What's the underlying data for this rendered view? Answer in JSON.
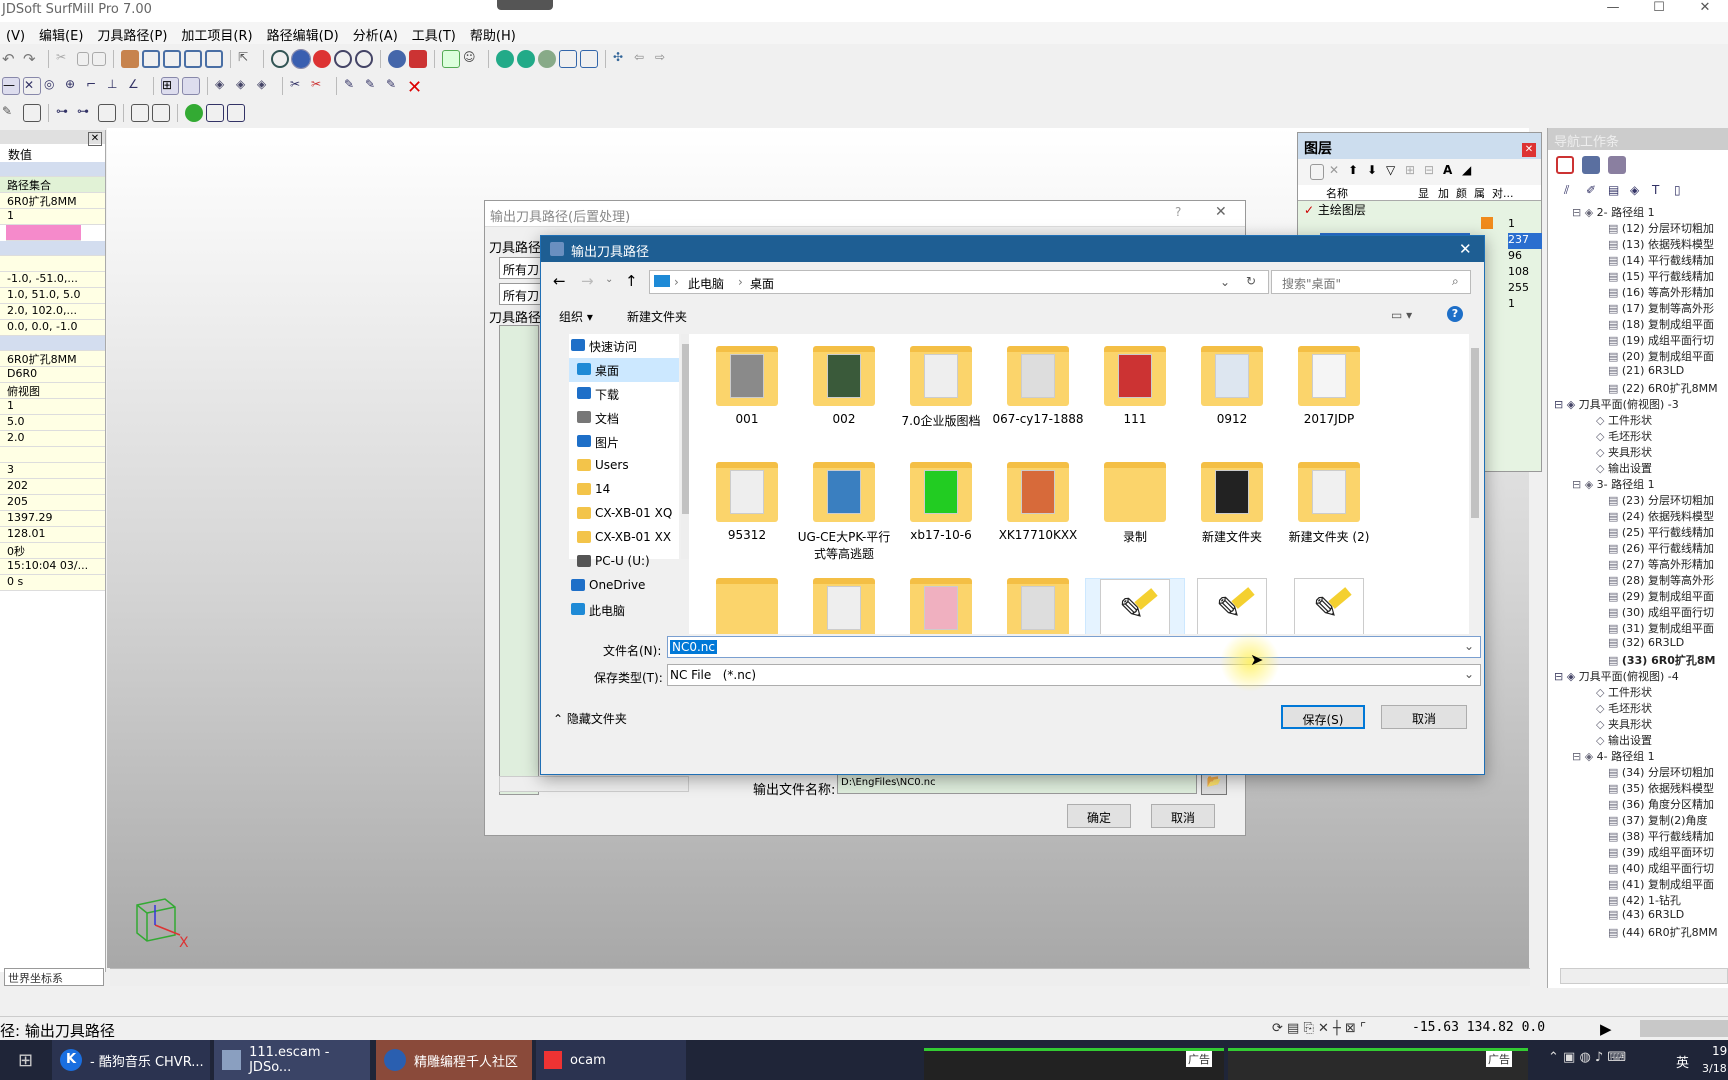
{
  "app": {
    "title": "JDSoft SurfMill Pro 7.00"
  },
  "menu": [
    "(V)",
    "编辑(E)",
    "刀具路径(P)",
    "加工项目(R)",
    "路径编辑(D)",
    "分析(A)",
    "工具(T)",
    "帮助(H)"
  ],
  "left_panel": {
    "header": "数值",
    "rows": [
      {
        "text": "路径集合",
        "cls": "green"
      },
      {
        "text": "6R0扩孔8MM"
      },
      {
        "text": "1"
      },
      {
        "text": "",
        "cls": "pink"
      },
      {
        "text": "",
        "cls": "hdr"
      },
      {
        "text": ""
      },
      {
        "text": "-1.0, -51.0,..."
      },
      {
        "text": "1.0, 51.0, 5.0"
      },
      {
        "text": "2.0, 102.0,..."
      },
      {
        "text": "0.0, 0.0, -1.0"
      },
      {
        "text": "",
        "cls": "hdr"
      },
      {
        "text": "6R0扩孔8MM"
      },
      {
        "text": "D6R0"
      },
      {
        "text": "俯视图"
      },
      {
        "text": "1"
      },
      {
        "text": "5.0"
      },
      {
        "text": "2.0"
      },
      {
        "text": ""
      },
      {
        "text": "3"
      },
      {
        "text": "202"
      },
      {
        "text": "205"
      },
      {
        "text": "1397.29"
      },
      {
        "text": "128.01"
      },
      {
        "text": "0秒"
      },
      {
        "text": "15:10:04 03/..."
      },
      {
        "text": "0 s"
      }
    ],
    "coord_label": "世界坐标系"
  },
  "layer_panel": {
    "title": "图层",
    "columns": [
      "名称",
      "显",
      "加",
      "颜",
      "属",
      "对..."
    ],
    "main_layer": "主绘图层",
    "values": [
      "1",
      "237",
      "96",
      "108",
      "255",
      "1"
    ]
  },
  "nav_panel": {
    "title": "导航工作条",
    "tree": [
      "2- 路径组 1",
      "(12) 分层环切粗加",
      "(13) 依据残料模型",
      "(14) 平行截线精加",
      "(15) 平行截线精加",
      "(16) 等高外形精加",
      "(17) 复制等高外形",
      "(18) 复制成组平面",
      "(19) 成组平面行切",
      "(20) 复制成组平面",
      "(21) 6R3LD",
      "(22) 6R0扩孔8MM",
      "刀具平面(俯视图) -3",
      "工件形状",
      "毛坯形状",
      "夹具形状",
      "输出设置",
      "3- 路径组 1",
      "(23) 分层环切粗加",
      "(24) 依据残料模型",
      "(25) 平行截线精加",
      "(26) 平行截线精加",
      "(27) 等高外形精加",
      "(28) 复制等高外形",
      "(29) 复制成组平面",
      "(30) 成组平面行切",
      "(31) 复制成组平面",
      "(32) 6R3LD",
      "(33) 6R0扩孔8M",
      "刀具平面(俯视图) -4",
      "工件形状",
      "毛坯形状",
      "夹具形状",
      "输出设置",
      "4- 路径组 1",
      "(34) 分层环切粗加",
      "(35) 依据残料模型",
      "(36) 角度分区精加",
      "(37) 复制(2)角度",
      "(38) 平行截线精加",
      "(39) 成组平面环切",
      "(40) 成组平面行切",
      "(41) 复制成组平面",
      "(42) 1-钻孔",
      "(43) 6R3LD",
      "(44) 6R0扩孔8MM"
    ]
  },
  "bg_dialog": {
    "title": "输出刀具路径(后置处理)",
    "label1": "刀具路径",
    "combo1": "所有刀",
    "combo2": "所有刀",
    "label2": "刀具路径",
    "output_label": "输出文件名称:",
    "output_value": "D:\\EngFiles\\NC0.nc",
    "ok": "确定",
    "cancel": "取消"
  },
  "save_dialog": {
    "title": "输出刀具路径",
    "breadcrumb": [
      "此电脑",
      "桌面"
    ],
    "search_placeholder": "搜索\"桌面\"",
    "organize": "组织",
    "new_folder": "新建文件夹",
    "nav_items": [
      {
        "label": "快速访问",
        "icon": "star"
      },
      {
        "label": "桌面",
        "icon": "desktop",
        "sel": true
      },
      {
        "label": "下载",
        "icon": "download"
      },
      {
        "label": "文档",
        "icon": "doc"
      },
      {
        "label": "图片",
        "icon": "pic"
      },
      {
        "label": "Users",
        "icon": "folder"
      },
      {
        "label": "14",
        "icon": "folder"
      },
      {
        "label": "CX-XB-01 XQ",
        "icon": "folder"
      },
      {
        "label": "CX-XB-01 XX",
        "icon": "folder"
      },
      {
        "label": "PC-U (U:)",
        "icon": "drive"
      },
      {
        "label": "OneDrive",
        "icon": "cloud"
      },
      {
        "label": "此电脑",
        "icon": "pc"
      }
    ],
    "files": [
      {
        "name": "001",
        "type": "folder"
      },
      {
        "name": "002",
        "type": "folder"
      },
      {
        "name": "7.0企业版图档",
        "type": "folder"
      },
      {
        "name": "067-cy17-1888",
        "type": "folder"
      },
      {
        "name": "111",
        "type": "folder"
      },
      {
        "name": "0912",
        "type": "folder"
      },
      {
        "name": "2017JDP",
        "type": "folder"
      },
      {
        "name": "95312",
        "type": "folder"
      },
      {
        "name": "UG-CE大PK-平行式等高逃题",
        "type": "folder"
      },
      {
        "name": "xb17-10-6",
        "type": "folder"
      },
      {
        "name": "XK17710KXX",
        "type": "folder"
      },
      {
        "name": "录制",
        "type": "folder"
      },
      {
        "name": "新建文件夹",
        "type": "folder"
      },
      {
        "name": "新建文件夹 (2)",
        "type": "folder"
      },
      {
        "name": "",
        "type": "folder"
      },
      {
        "name": "",
        "type": "folder"
      },
      {
        "name": "",
        "type": "folder"
      },
      {
        "name": "",
        "type": "folder"
      },
      {
        "name": "",
        "type": "nc"
      },
      {
        "name": "",
        "type": "nc"
      },
      {
        "name": "",
        "type": "nc"
      }
    ],
    "filename_label": "文件名(N):",
    "filename_value": "NC0.nc",
    "filetype_label": "保存类型(T):",
    "filetype_value": "NC File   (*.nc)",
    "hide_folders": "隐藏文件夹",
    "save": "保存(S)",
    "cancel": "取消"
  },
  "status": {
    "text": "径: 输出刀具路径",
    "coords": "-15.63 134.82 0.0"
  },
  "taskbar": {
    "items": [
      "- 酷狗音乐 CHVR...",
      "111.escam - JDSo...",
      "精雕编程千人社区",
      "ocam"
    ],
    "ad": "广告",
    "ime": "英",
    "time": "19",
    "date": "3/18"
  }
}
